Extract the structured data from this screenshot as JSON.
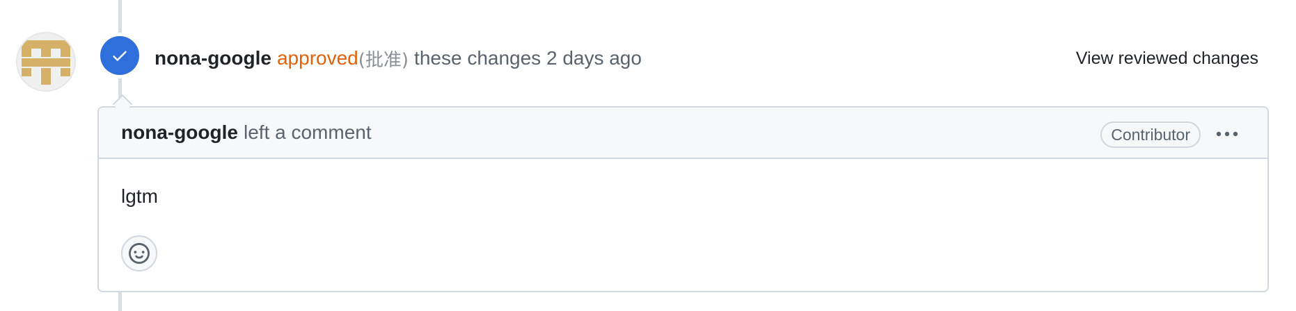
{
  "review_event": {
    "author": "nona-google",
    "state": "approved",
    "state_note": "(批准)",
    "suffix": "these changes 2 days ago",
    "view_changes_label": "View reviewed changes",
    "badge_color": "#2f6fdc",
    "state_color": "#e36209"
  },
  "comment": {
    "author": "nona-google",
    "action": "left a comment",
    "role_badge": "Contributor",
    "body": "lgtm",
    "icons": {
      "menu": "kebab-horizontal-icon",
      "reaction": "smiley-icon",
      "badge": "check-icon"
    }
  },
  "avatar": {
    "colors": {
      "foreground": "#d4b166",
      "background": "#f0f0f0"
    }
  }
}
